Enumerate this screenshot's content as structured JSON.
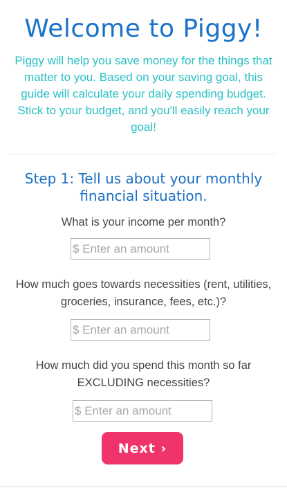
{
  "header": {
    "title": "Welcome to Piggy!",
    "intro": "Piggy will help you save money for the things that matter to you. Based on your saving goal, this guide will calculate your daily spending budget. Stick to your budget, and you'll easily reach your goal!"
  },
  "step": {
    "title": "Step 1: Tell us about your monthly financial situation."
  },
  "questions": [
    {
      "label": "What is your income per month?",
      "placeholder": "$ Enter an amount",
      "value": ""
    },
    {
      "label": "How much goes towards necessities (rent, utilities, groceries, insurance, fees, etc.)?",
      "placeholder": "$ Enter an amount",
      "value": ""
    },
    {
      "label": "How much did you spend this month so far EXCLUDING necessities?",
      "placeholder": "$ Enter an amount",
      "value": ""
    }
  ],
  "actions": {
    "next_label": "Next ›"
  },
  "colors": {
    "title": "#1a73c9",
    "intro": "#2bbfc4",
    "step_title": "#1a6ec2",
    "button": "#f0336a"
  }
}
